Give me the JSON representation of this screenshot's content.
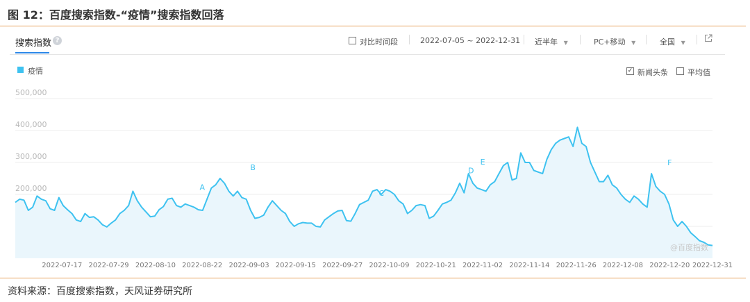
{
  "figure_title": "图 12：百度搜索指数-“疫情”搜索指数回落",
  "source": "资料来源：百度搜索指数，天风证券研究所",
  "toolbar": {
    "tab_label": "搜索指数",
    "help_icon": "?",
    "compare_label": "对比时间段",
    "date_range": "2022-07-05 ~ 2022-12-31",
    "period": "近半年",
    "device": "PC+移动",
    "region": "全国",
    "external_icon": "external-link-icon"
  },
  "legend_controls": {
    "news_label": "新闻头条",
    "news_checked": true,
    "average_label": "平均值",
    "average_checked": false
  },
  "colors": {
    "series": "#3EC2F0",
    "area": "#EAF6FC",
    "grid": "#eeeeee",
    "accent_rule": "#E6A15B"
  },
  "watermark": "@百度指数",
  "chart_data": {
    "type": "area",
    "title": "",
    "xlabel": "",
    "ylabel": "",
    "ylim": [
      0,
      500000
    ],
    "yticks": [
      "500,000",
      "400,000",
      "300,000",
      "200,000",
      "100,000"
    ],
    "ytick_values": [
      500000,
      400000,
      300000,
      200000,
      100000
    ],
    "xticks": [
      "2022-07-17",
      "2022-07-29",
      "2022-08-10",
      "2022-08-22",
      "2022-09-03",
      "2022-09-15",
      "2022-09-27",
      "2022-10-09",
      "2022-10-21",
      "2022-11-02",
      "2022-11-14",
      "2022-11-26",
      "2022-12-08",
      "2022-12-20",
      "2022-12-31"
    ],
    "grid": true,
    "legend": "top-left",
    "series": [
      {
        "name": "疫情",
        "x_start": "2022-07-05",
        "x_end": "2022-12-31",
        "values": [
          175000,
          185000,
          182000,
          150000,
          160000,
          195000,
          185000,
          180000,
          155000,
          150000,
          190000,
          165000,
          152000,
          140000,
          120000,
          115000,
          140000,
          128000,
          130000,
          120000,
          105000,
          98000,
          110000,
          120000,
          140000,
          150000,
          165000,
          210000,
          180000,
          160000,
          145000,
          130000,
          132000,
          152000,
          162000,
          185000,
          188000,
          165000,
          160000,
          170000,
          165000,
          160000,
          152000,
          150000,
          185000,
          220000,
          230000,
          250000,
          235000,
          210000,
          195000,
          210000,
          190000,
          185000,
          150000,
          125000,
          128000,
          135000,
          160000,
          180000,
          165000,
          150000,
          140000,
          115000,
          100000,
          108000,
          112000,
          110000,
          110000,
          100000,
          98000,
          120000,
          130000,
          140000,
          148000,
          150000,
          118000,
          116000,
          140000,
          168000,
          175000,
          182000,
          210000,
          215000,
          200000,
          215000,
          210000,
          200000,
          180000,
          170000,
          140000,
          150000,
          165000,
          168000,
          165000,
          125000,
          132000,
          150000,
          170000,
          175000,
          182000,
          205000,
          235000,
          205000,
          265000,
          235000,
          220000,
          215000,
          210000,
          230000,
          240000,
          265000,
          290000,
          300000,
          245000,
          250000,
          330000,
          300000,
          300000,
          275000,
          270000,
          265000,
          310000,
          340000,
          360000,
          370000,
          375000,
          380000,
          350000,
          410000,
          360000,
          350000,
          300000,
          270000,
          240000,
          240000,
          260000,
          230000,
          220000,
          200000,
          185000,
          175000,
          195000,
          185000,
          170000,
          160000,
          265000,
          225000,
          210000,
          200000,
          170000,
          120000,
          100000,
          115000,
          100000,
          80000,
          68000,
          55000,
          50000,
          42000,
          40000
        ]
      }
    ],
    "annotations": [
      {
        "label": "A",
        "x": "2022-08-22",
        "y": 188000
      },
      {
        "label": "B",
        "x": "2022-09-04",
        "y": 250000
      },
      {
        "label": "C",
        "x": "2022-10-07",
        "y": 170000
      },
      {
        "label": "D",
        "x": "2022-10-30",
        "y": 240000
      },
      {
        "label": "E",
        "x": "2022-11-02",
        "y": 267000
      },
      {
        "label": "F",
        "x": "2022-12-20",
        "y": 265000
      }
    ]
  }
}
